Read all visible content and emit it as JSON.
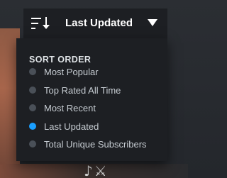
{
  "sort": {
    "current_label": "Last Updated",
    "icon": "sort-icon",
    "caret_icon": "caret-down-icon"
  },
  "menu": {
    "title": "SORT ORDER",
    "options": [
      {
        "label": "Most Popular",
        "selected": false
      },
      {
        "label": "Top Rated All Time",
        "selected": false
      },
      {
        "label": "Most Recent",
        "selected": false
      },
      {
        "label": "Last Updated",
        "selected": true
      },
      {
        "label": "Total Unique Subscribers",
        "selected": false
      }
    ]
  },
  "colors": {
    "accent": "#1a9fff",
    "radio_idle": "#4a5058",
    "panel_bg": "#1d1f23"
  }
}
